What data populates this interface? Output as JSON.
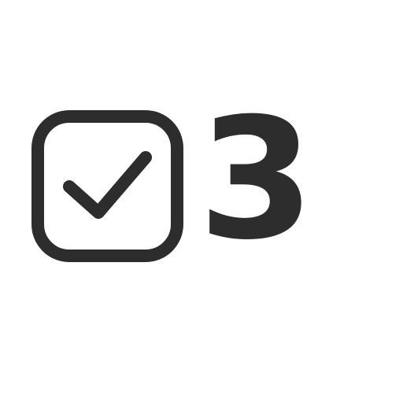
{
  "checkbox": {
    "icon": "checkbox-checked-icon",
    "checked": true
  },
  "count": {
    "value": "3"
  },
  "colors": {
    "foreground": "#2d2d2d",
    "background": "#ffffff"
  }
}
